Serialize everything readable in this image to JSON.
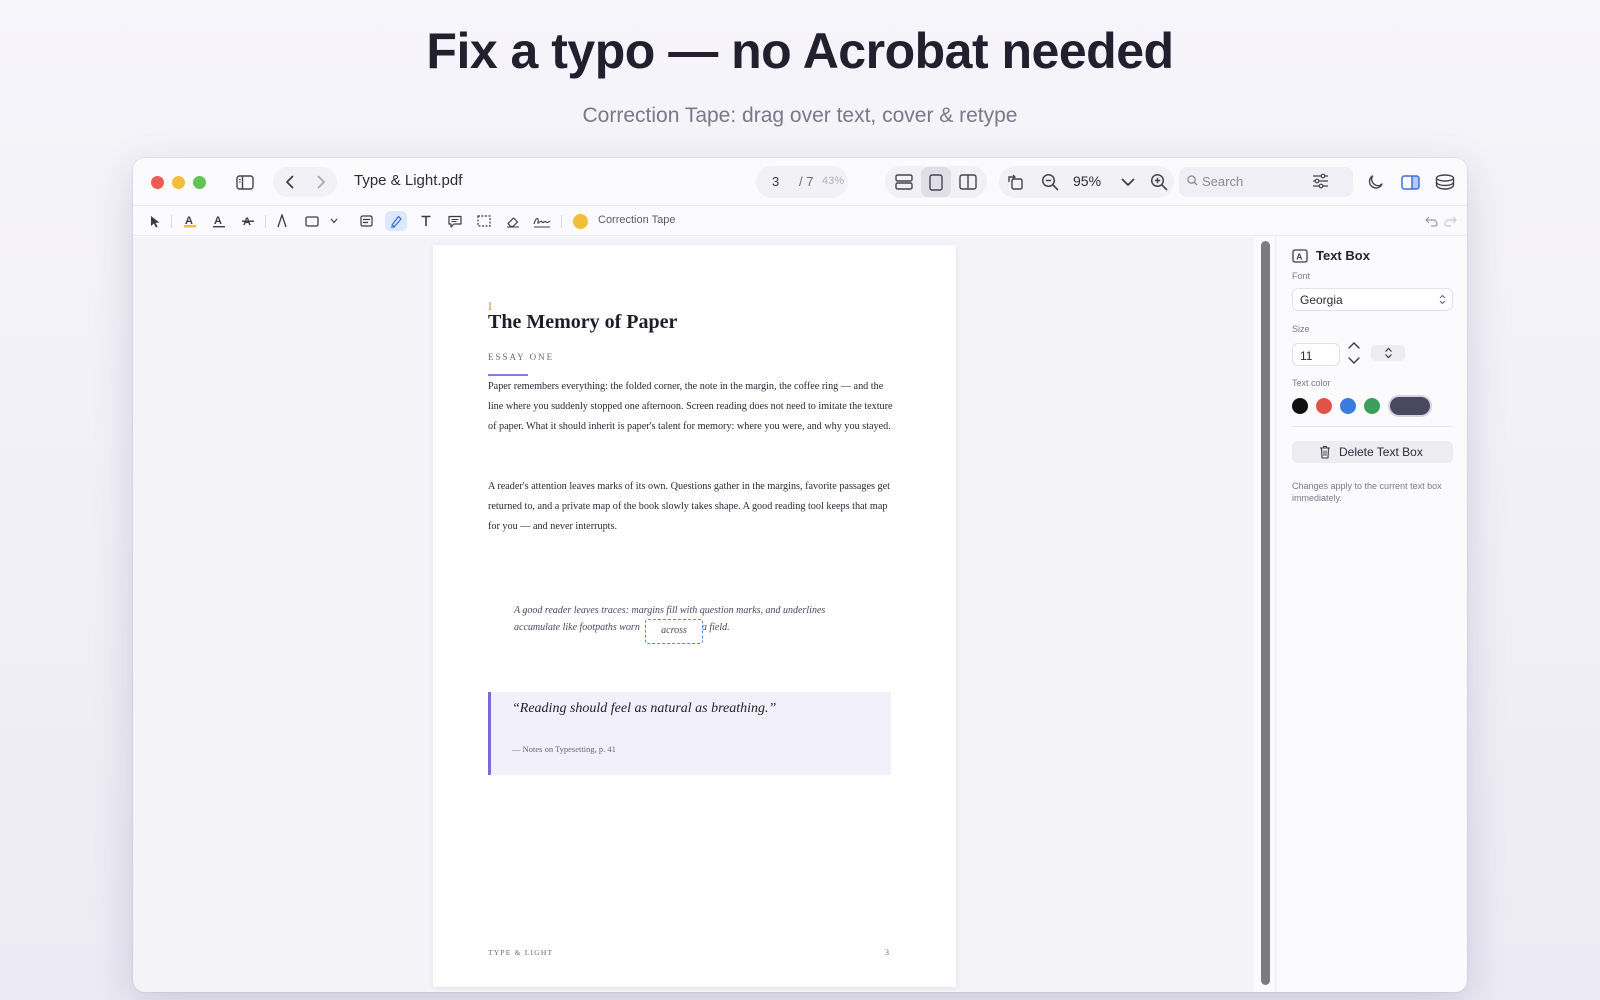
{
  "hero": {
    "title": "Fix a typo — no Acrobat needed",
    "subtitle": "Correction Tape: drag over text, cover & retype"
  },
  "window": {
    "file_name": "Type & Light.pdf",
    "page_current": "3",
    "page_total": "/ 7",
    "page_percent": "43%",
    "zoom": "95%",
    "search_placeholder": "Search"
  },
  "toolbar": {
    "active_tool_label": "Correction Tape",
    "tape_color": "#f1be35"
  },
  "document": {
    "caret": "I",
    "title": "The Memory of Paper",
    "essay_label": "ESSAY ONE",
    "paragraph1": "Paper remembers everything: the folded corner, the note in the margin, the coffee ring — and the line where you suddenly stopped one afternoon. Screen reading does not need to imitate the texture of paper. What it should inherit is paper's talent for memory: where you were, and why you stayed.",
    "paragraph2": "A reader's attention leaves marks of its own. Questions gather in the margins, favorite passages get returned to, and a private map of the book slowly takes shape. A good reading tool keeps that map for you — and never interrupts.",
    "italic_line1": "A good reader leaves traces: margins fill with question marks, and underlines",
    "italic_line2_before": "accumulate like footpaths worn",
    "italic_line2_after": "a field.",
    "tape_text": "across",
    "quote": "“Reading should feel as natural as breathing.”",
    "quote_cite": "— Notes on Typesetting, p. 41",
    "footer_left": "TYPE & LIGHT",
    "footer_right": "3"
  },
  "inspector": {
    "title": "Text Box",
    "font_label": "Font",
    "font_value": "Georgia",
    "size_label": "Size",
    "size_value": "11",
    "color_label": "Text color",
    "swatches": [
      "#111111",
      "#e0524a",
      "#3a7be0",
      "#3a9f5c",
      "#4a4761"
    ],
    "delete_label": "Delete Text Box",
    "help_text": "Changes apply to the current text box immediately."
  }
}
